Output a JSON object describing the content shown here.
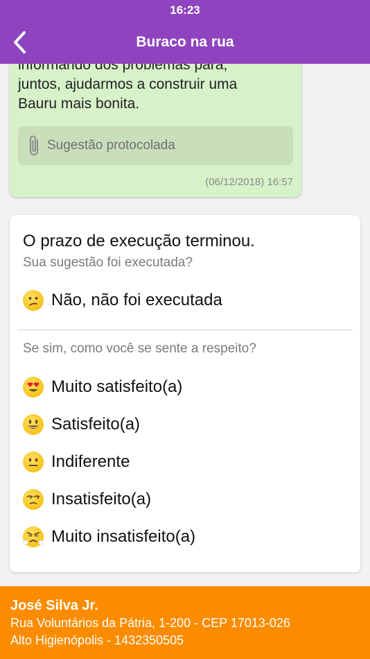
{
  "status_bar": {
    "time": "16:23"
  },
  "nav": {
    "title": "Buraco na rua",
    "back_icon": "chevron-left-icon"
  },
  "message": {
    "lines": [
      "informando dos problemas para,",
      "juntos, ajudarmos a construir uma",
      "Bauru mais bonita."
    ],
    "attachment_label": "Sugestão protocolada",
    "attachment_icon": "paperclip-icon",
    "timestamp": "(06/12/2018) 16:57"
  },
  "survey": {
    "title": "O prazo de execução terminou.",
    "question1": "Sua sugestão foi executada?",
    "not_executed": {
      "label": "Não, não foi executada",
      "icon": "confused-face-icon"
    },
    "question2": "Se sim, como você se sente a respeito?",
    "options": [
      {
        "label": "Muito satisfeito(a)",
        "icon": "heart-eyes-face-icon"
      },
      {
        "label": "Satisfeito(a)",
        "icon": "smiling-face-icon"
      },
      {
        "label": "Indiferente",
        "icon": "neutral-face-icon"
      },
      {
        "label": "Insatisfeito(a)",
        "icon": "unamused-face-icon"
      },
      {
        "label": "Muito insatisfeito(a)",
        "icon": "angry-face-icon"
      }
    ]
  },
  "footer": {
    "name": "José Silva Jr.",
    "address": "Rua Voluntários da Pátria, 1-200 - CEP 17013-026",
    "district_phone": "Alto Higienópolis - 1432350505"
  },
  "colors": {
    "header": "#8e44bf",
    "footer": "#fb8c00",
    "message_bubble": "#d7f2c9"
  }
}
